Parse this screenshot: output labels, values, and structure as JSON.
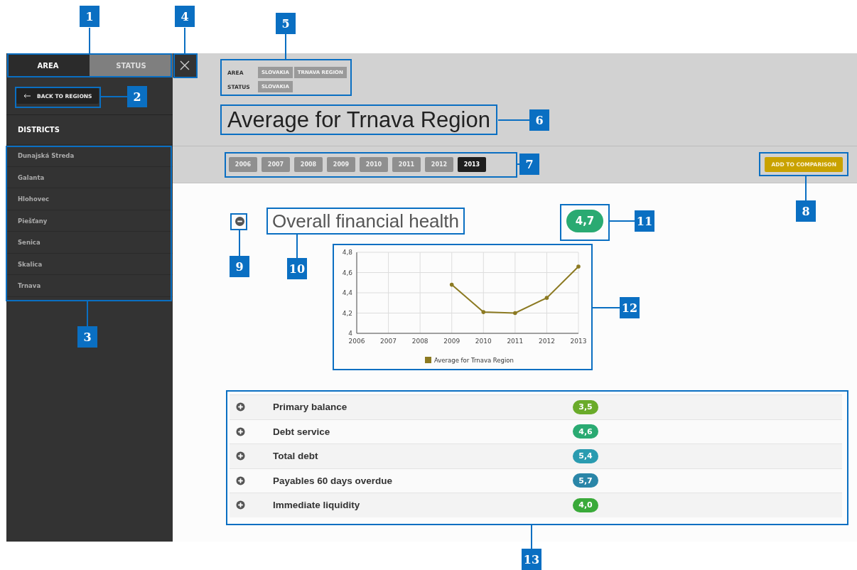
{
  "sidebar": {
    "tabs": [
      {
        "label": "AREA",
        "selected": true
      },
      {
        "label": "STATUS",
        "selected": false
      }
    ],
    "back_button": "BACK TO REGIONS",
    "districts": {
      "heading": "DISTRICTS",
      "items": [
        "Dunajská Streda",
        "Galanta",
        "Hlohovec",
        "Piešťany",
        "Senica",
        "Skalica",
        "Trnava"
      ]
    }
  },
  "header": {
    "filters": [
      {
        "label": "AREA",
        "tags": [
          "SLOVAKIA",
          "TRNAVA REGION"
        ]
      },
      {
        "label": "STATUS",
        "tags": [
          "SLOVAKIA"
        ]
      }
    ],
    "title": "Average for Trnava Region"
  },
  "years": [
    {
      "label": "2006",
      "selected": false
    },
    {
      "label": "2007",
      "selected": false
    },
    {
      "label": "2008",
      "selected": false
    },
    {
      "label": "2009",
      "selected": false
    },
    {
      "label": "2010",
      "selected": false
    },
    {
      "label": "2011",
      "selected": false
    },
    {
      "label": "2012",
      "selected": false
    },
    {
      "label": "2013",
      "selected": true
    }
  ],
  "add_button": "ADD TO COMPARISON",
  "section": {
    "title": "Overall financial health",
    "expanded": true,
    "score": "4,7",
    "chart_data": {
      "type": "line",
      "grid": true,
      "x": [
        2009,
        2010,
        2011,
        2012,
        2013
      ],
      "series": [
        {
          "name": "Average for Trnava Region",
          "color": "#8c7a22",
          "values": [
            4.48,
            4.21,
            4.2,
            4.35,
            4.66
          ]
        }
      ],
      "xlim": [
        2006,
        2013
      ],
      "ylim": [
        4,
        4.8
      ],
      "xticks": [
        2006,
        2007,
        2008,
        2009,
        2010,
        2011,
        2012,
        2013
      ],
      "yticks": [
        {
          "value": 4,
          "label": "4"
        },
        {
          "value": 4.2,
          "label": "4,2"
        },
        {
          "value": 4.4,
          "label": "4,4"
        },
        {
          "value": 4.6,
          "label": "4,6"
        },
        {
          "value": 4.8,
          "label": "4,8"
        }
      ]
    },
    "rows": [
      {
        "label": "Primary balance",
        "score": "3,5",
        "color": "#6aab2a",
        "expanded": false
      },
      {
        "label": "Debt service",
        "score": "4,6",
        "color": "#2aaa72",
        "expanded": false
      },
      {
        "label": "Total debt",
        "score": "5,4",
        "color": "#2a9bb0",
        "expanded": false
      },
      {
        "label": "Payables 60 days overdue",
        "score": "5,7",
        "color": "#2a86a8",
        "expanded": false
      },
      {
        "label": "Immediate liquidity",
        "score": "4,0",
        "color": "#3aaa3a",
        "expanded": false
      }
    ]
  },
  "callouts": [
    "1",
    "2",
    "3",
    "4",
    "5",
    "6",
    "7",
    "8",
    "9",
    "10",
    "11",
    "12",
    "13"
  ]
}
